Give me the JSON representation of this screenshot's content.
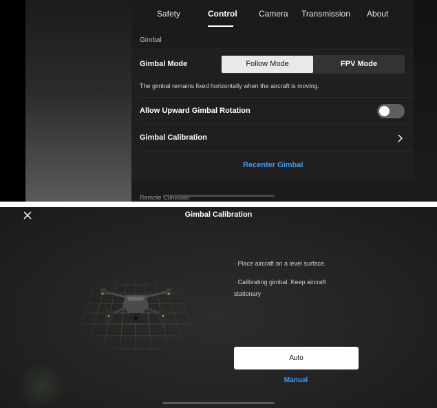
{
  "settings": {
    "tabs": [
      {
        "label": "Safety"
      },
      {
        "label": "Control"
      },
      {
        "label": "Camera"
      },
      {
        "label": "Transmission"
      },
      {
        "label": "About"
      }
    ],
    "active_tab": "Control",
    "section_label": "Gimbal",
    "gimbal_mode": {
      "label": "Gimbal Mode",
      "options": [
        "Follow Mode",
        "FPV Mode"
      ],
      "selected": "Follow Mode"
    },
    "mode_description": "The gimbal remains fixed horizontally when the aircraft is moving.",
    "upward_rotation": {
      "label": "Allow Upward Gimbal Rotation",
      "enabled": false
    },
    "calibration_row": {
      "label": "Gimbal Calibration"
    },
    "recenter_label": "Recenter Gimbal",
    "next_section_label": "Remote Controller"
  },
  "calibration": {
    "title": "Gimbal Calibration",
    "instructions": [
      "· Place aircraft on a level surface.",
      "· Calibrating gimbal. Keep aircraft stationary"
    ],
    "auto_label": "Auto",
    "manual_label": "Manual"
  },
  "colors": {
    "accent": "#3f9bf0",
    "grid": "#c8a04a"
  },
  "icons": {
    "close": "close-icon",
    "chevron": "chevron-right-icon"
  }
}
